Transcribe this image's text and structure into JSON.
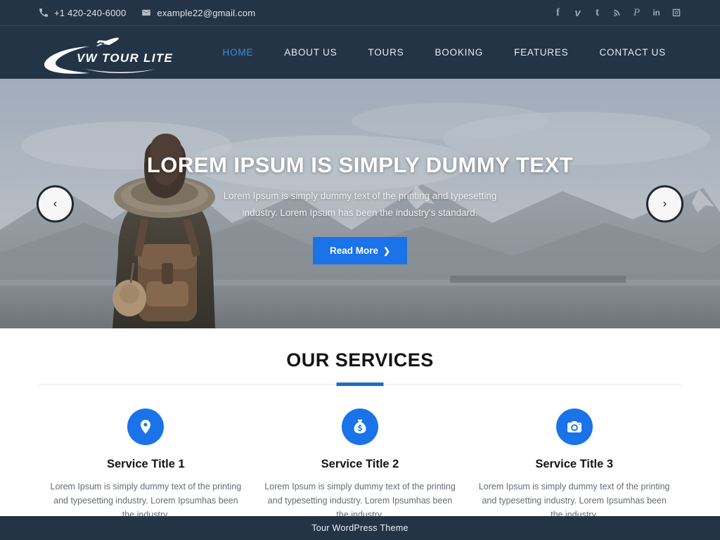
{
  "topbar": {
    "phone": "+1 420-240-6000",
    "email": "example22@gmail.com",
    "phone_icon": "phone-icon",
    "email_icon": "envelope-icon",
    "social": [
      {
        "name": "facebook-icon",
        "glyph": "f"
      },
      {
        "name": "vimeo-icon",
        "glyph": "v"
      },
      {
        "name": "tumblr-icon",
        "glyph": "t"
      },
      {
        "name": "rss-icon",
        "glyph": ""
      },
      {
        "name": "pinterest-icon",
        "glyph": "P"
      },
      {
        "name": "linkedin-icon",
        "glyph": "in"
      },
      {
        "name": "instagram-icon",
        "glyph": ""
      }
    ]
  },
  "header": {
    "logo_text": "VW TOUR LITE",
    "nav": [
      {
        "label": "HOME",
        "active": true
      },
      {
        "label": "ABOUT US",
        "active": false
      },
      {
        "label": "TOURS",
        "active": false
      },
      {
        "label": "BOOKING",
        "active": false
      },
      {
        "label": "FEATURES",
        "active": false
      },
      {
        "label": "CONTACT US",
        "active": false
      }
    ]
  },
  "hero": {
    "title": "LOREM IPSUM IS SIMPLY DUMMY TEXT",
    "subtitle": "Lorem Ipsum is simply dummy text of the printing and typesetting industry. Lorem Ipsum has been the industry's standard.",
    "cta_label": "Read More",
    "cta_chevron": "❯",
    "prev_label": "‹",
    "next_label": "›"
  },
  "services": {
    "heading": "OUR SERVICES",
    "items": [
      {
        "icon": "map-pin-icon",
        "title": "Service Title 1",
        "desc": "Lorem Ipsum is simply dummy text of the printing and typesetting industry. Lorem Ipsumhas been the industry."
      },
      {
        "icon": "money-bag-icon",
        "title": "Service Title 2",
        "desc": "Lorem Ipsum is simply dummy text of the printing and typesetting industry. Lorem Ipsumhas been the industry."
      },
      {
        "icon": "camera-icon",
        "title": "Service Title 3",
        "desc": "Lorem Ipsum is simply dummy text of the printing and typesetting industry. Lorem Ipsumhas been the industry."
      }
    ]
  },
  "footer": {
    "text": "Tour WordPress Theme"
  },
  "colors": {
    "header_bg": "#243447",
    "accent_blue": "#1a73e8",
    "nav_active": "#3b8ee0",
    "rule_blue": "#1a6fc4"
  }
}
